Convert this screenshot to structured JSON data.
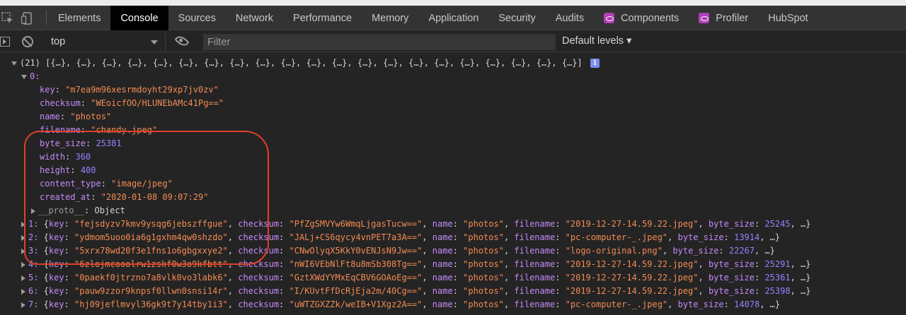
{
  "tabs": [
    "Elements",
    "Console",
    "Sources",
    "Network",
    "Performance",
    "Memory",
    "Application",
    "Security",
    "Audits",
    "Components",
    "Profiler",
    "HubSpot"
  ],
  "toolbar": {
    "context": "top",
    "filter_placeholder": "Filter",
    "levels": "Default levels ▾"
  },
  "console": {
    "summary_count": "(21)",
    "summary": "[{…}, {…}, {…}, {…}, {…}, {…}, {…}, {…}, {…}, {…}, {…}, {…}, {…}, {…}, {…}, {…}, {…}, {…}, {…}, {…}, {…}]",
    "expanded_index": "0:",
    "fields": [
      {
        "key": "key",
        "value": "\"m7ea9m96xesrmdoyht29xp7jv0zv\"",
        "kind": "s"
      },
      {
        "key": "checksum",
        "value": "\"WEoicfOO/HLUNEbAMc41Pg==\"",
        "kind": "s"
      },
      {
        "key": "name",
        "value": "\"photos\"",
        "kind": "s"
      },
      {
        "key": "filename",
        "value": "\"chandy.jpeg\"",
        "kind": "s"
      },
      {
        "key": "byte_size",
        "value": "25381",
        "kind": "n"
      },
      {
        "key": "width",
        "value": "360",
        "kind": "n"
      },
      {
        "key": "height",
        "value": "400",
        "kind": "n"
      },
      {
        "key": "content_type",
        "value": "\"image/jpeg\"",
        "kind": "s"
      },
      {
        "key": "created_at",
        "value": "\"2020-01-08 09:07:29\"",
        "kind": "s"
      }
    ],
    "proto_key": "__proto__",
    "proto_value": "Object",
    "rows": [
      {
        "idx": "1:",
        "key": "\"fejsdyzv7kmv9ysqg6jebszffgue\"",
        "checksum": "\"PfZgSMVYw6WmqLjgasTucw==\"",
        "name": "\"photos\"",
        "filename": "\"2019-12-27-14.59.22.jpeg\"",
        "byte_size": "25245"
      },
      {
        "idx": "2:",
        "key": "\"ydmom5uoo0ia6g1gxhm4qw0shzdo\"",
        "checksum": "\"JALj+CS6qycy4vnPET7a3A==\"",
        "name": "\"photos\"",
        "filename": "\"pc-computer-_.jpeg\"",
        "byte_size": "13914"
      },
      {
        "idx": "3:",
        "key": "\"5xrx78wd20f3e1fns1o6gbgxxye2\"",
        "checksum": "\"CNwOlyqX5KkY0vENJsN9Jw==\"",
        "name": "\"photos\"",
        "filename": "\"logo-original.png\"",
        "byte_size": "22267"
      },
      {
        "idx": "4:",
        "key": "\"6zlojmcooolrw1zskf0w3o9kfbtt\"",
        "checksum": "\"nWI6VEbNlFt8u8mSb308Tg==\"",
        "name": "\"photos\"",
        "filename": "\"2019-12-27-14.59.22.jpeg\"",
        "byte_size": "25291"
      },
      {
        "idx": "5:",
        "key": "\"0paekf0jtrzno7a8vlk0vo3labk6\"",
        "checksum": "\"GztXWdYYMxEqCBV6GOAoEg==\"",
        "name": "\"photos\"",
        "filename": "\"2019-12-27-14.59.22.jpeg\"",
        "byte_size": "25361"
      },
      {
        "idx": "6:",
        "key": "\"pauw9zzor9knpsf0llwn0snsi14r\"",
        "checksum": "\"I/KUvtFfDcRjEja2m/40Cg==\"",
        "name": "\"photos\"",
        "filename": "\"2019-12-27-14.59.22.jpeg\"",
        "byte_size": "25398"
      },
      {
        "idx": "7:",
        "key": "\"hj09jeflmvyl36gk9t7y14tby1i3\"",
        "checksum": "\"uWTZGXZZk/weIB+V1Xgz2A==\"",
        "name": "\"photos\"",
        "filename": "\"pc-computer-_.jpeg\"",
        "byte_size": "14078"
      }
    ],
    "labels": {
      "key": "key",
      "checksum": "checksum",
      "name": "name",
      "filename": "filename",
      "byte_size": "byte_size",
      "ellipsis": "…}"
    }
  },
  "colors": {
    "string": "#f28b54",
    "number": "#9980ff",
    "property": "#c58af9",
    "annotation": "#e0402a"
  },
  "icons": [
    "inspect-icon",
    "device-icon",
    "sidebar-toggle-icon",
    "clear-console-icon",
    "eye-icon",
    "info-icon",
    "react-components-icon"
  ]
}
